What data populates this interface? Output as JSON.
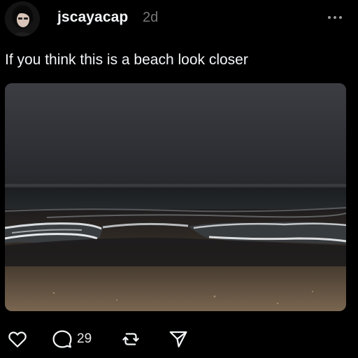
{
  "post": {
    "username": "jscayacap",
    "timestamp": "2d",
    "caption": "If you think this is a beach look closer",
    "media": {
      "type": "photo",
      "subject": "night beach"
    }
  },
  "actions": {
    "reply_count": "29"
  },
  "icons": {
    "more": "more-horizontal-icon",
    "like": "heart-icon",
    "reply": "comment-bubble-icon",
    "repost": "repost-icon",
    "share": "send-icon"
  },
  "colors": {
    "background": "#000000",
    "text": "#f3f5f7",
    "muted": "#777777"
  }
}
